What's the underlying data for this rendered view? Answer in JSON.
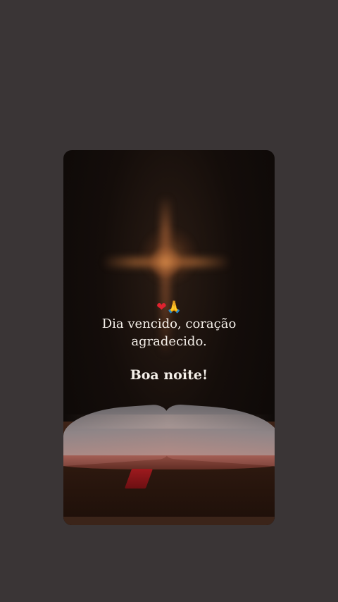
{
  "post": {
    "emoji_heart": "❤",
    "emoji_pray": "🙏",
    "line1": "Dia vencido, coração",
    "line2": "agradecido.",
    "closing": "Boa noite!"
  },
  "colors": {
    "page_background": "#3a3536",
    "text": "#f4efe9",
    "heart": "#e0222f"
  },
  "icons": [
    "heart-icon",
    "praying-hands-icon",
    "cross-icon",
    "open-bible-icon"
  ]
}
